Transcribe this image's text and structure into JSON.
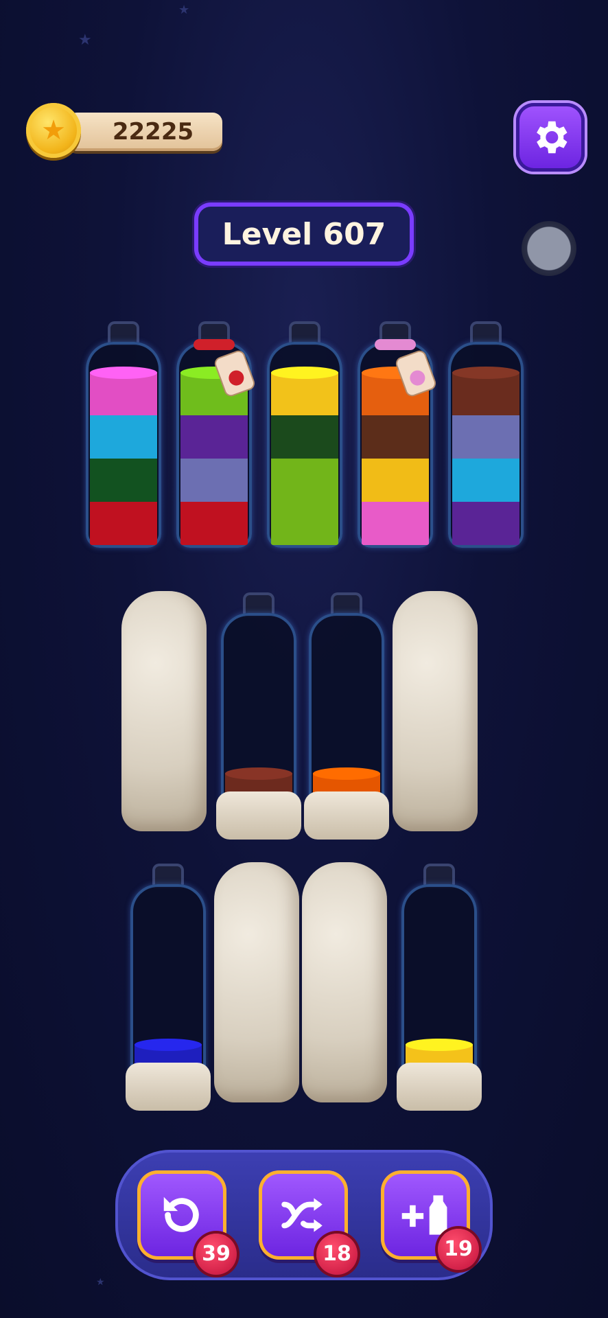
{
  "hud": {
    "coins": "22225",
    "level": "Level 607",
    "icons": {
      "coin": "star-coin-icon",
      "settings": "gear-icon"
    }
  },
  "board": {
    "row1": [
      {
        "layers": [
          "#c01120",
          "#125220",
          "#1ea8dc",
          "#e24ec4"
        ],
        "locked": false
      },
      {
        "layers": [
          "#c01120",
          "#6c6fb2",
          "#5a2496",
          "#6fbd1c"
        ],
        "locked": false,
        "tag": "#d0202a"
      },
      {
        "layers": [
          "#72b51a",
          "#72b51a",
          "#1b4a1c",
          "#f2c21a"
        ],
        "locked": false
      },
      {
        "layers": [
          "#e85bc8",
          "#f1bc17",
          "#5c2d1a",
          "#e55f0f"
        ],
        "locked": false,
        "tag": "#e48ad2"
      },
      {
        "layers": [
          "#5a2496",
          "#1ea8dc",
          "#6c6fb2",
          "#6a2c1e"
        ],
        "locked": false
      }
    ],
    "row2": [
      {
        "stone": true
      },
      {
        "layers": [
          "#6d2a1e"
        ],
        "stone_base": true
      },
      {
        "layers": [
          "#e55600"
        ],
        "stone_base": true
      },
      {
        "stone": true
      }
    ],
    "row3": [
      {
        "layers": [
          "#1e1fbe"
        ],
        "stone_base": true
      },
      {
        "stone": true
      },
      {
        "stone": true
      },
      {
        "layers": [
          "#f4c21a"
        ],
        "stone_base": true
      }
    ]
  },
  "tools": {
    "undo": {
      "count": "39",
      "icon": "undo-icon"
    },
    "shuffle": {
      "count": "18",
      "icon": "shuffle-icon"
    },
    "add_bottle": {
      "count": "19",
      "icon": "add-bottle-icon"
    }
  }
}
